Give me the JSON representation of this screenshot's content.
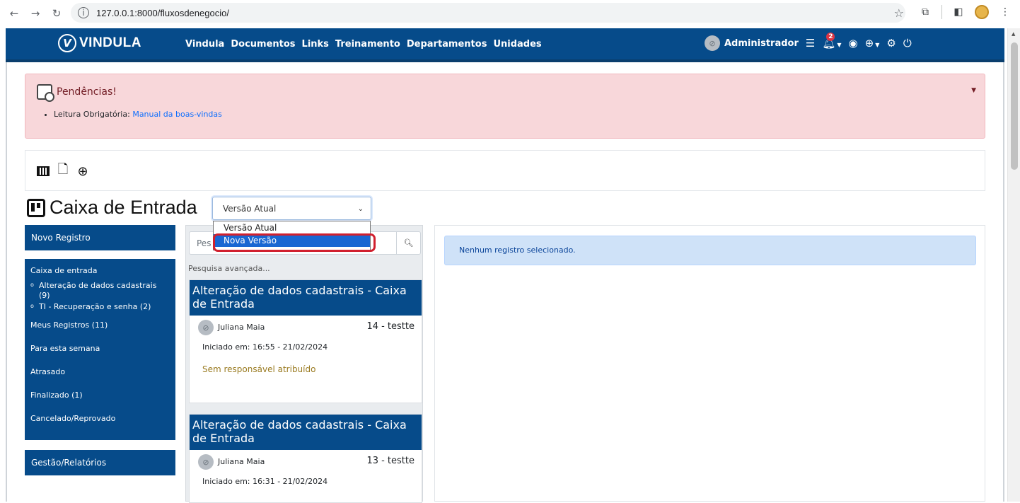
{
  "browser": {
    "url": "127.0.0.1:8000/fluxosdenegocio/"
  },
  "navbar": {
    "logo_text": "VINDULA",
    "menu": [
      "Vindula",
      "Documentos",
      "Links",
      "Treinamento",
      "Departamentos",
      "Unidades"
    ],
    "user_name": "Administrador",
    "notification_count": "2"
  },
  "alert": {
    "title": "Pendências!",
    "item_label": "Leitura Obrigatória:",
    "item_link": "Manual da boas-vindas"
  },
  "page": {
    "title": "Caixa de Entrada",
    "version_select": {
      "value": "Versão Atual",
      "options": [
        "Versão Atual",
        "Nova Versão"
      ],
      "highlighted": "Nova Versão"
    }
  },
  "sidebar": {
    "new_record": "Novo Registro",
    "inbox": "Caixa de entrada",
    "sub_items": [
      "Alteração de dados cadastrais (9)",
      "TI - Recuperação e senha (2)"
    ],
    "items": [
      "Meus Registros (11)",
      "Para esta semana",
      "Atrasado",
      "Finalizado (1)",
      "Cancelado/Reprovado"
    ],
    "reports": "Gestão/Relatórios"
  },
  "list": {
    "search_placeholder": "Pesquisar...",
    "search_placeholder_visible": "Pes",
    "advanced_search": "Pesquisa avançada...",
    "cards": [
      {
        "title": "Alteração de dados cadastrais - Caixa de Entrada",
        "user": "Juliana Maia",
        "id": "14 - testte",
        "date": "Iniciado em: 16:55 - 21/02/2024",
        "responsible": "Sem responsável atribuído"
      },
      {
        "title": "Alteração de dados cadastrais - Caixa de Entrada",
        "user": "Juliana Maia",
        "id": "13 - testte",
        "date": "Iniciado em: 16:31 - 21/02/2024",
        "responsible": ""
      }
    ]
  },
  "detail": {
    "empty_message": "Nenhum registro selecionado."
  },
  "colors": {
    "primary": "#064b8a",
    "alert_bg": "#f8d7da",
    "info_bg": "#cfe2f8",
    "highlight": "#d1202e",
    "responsible_text": "#9a7b21"
  }
}
